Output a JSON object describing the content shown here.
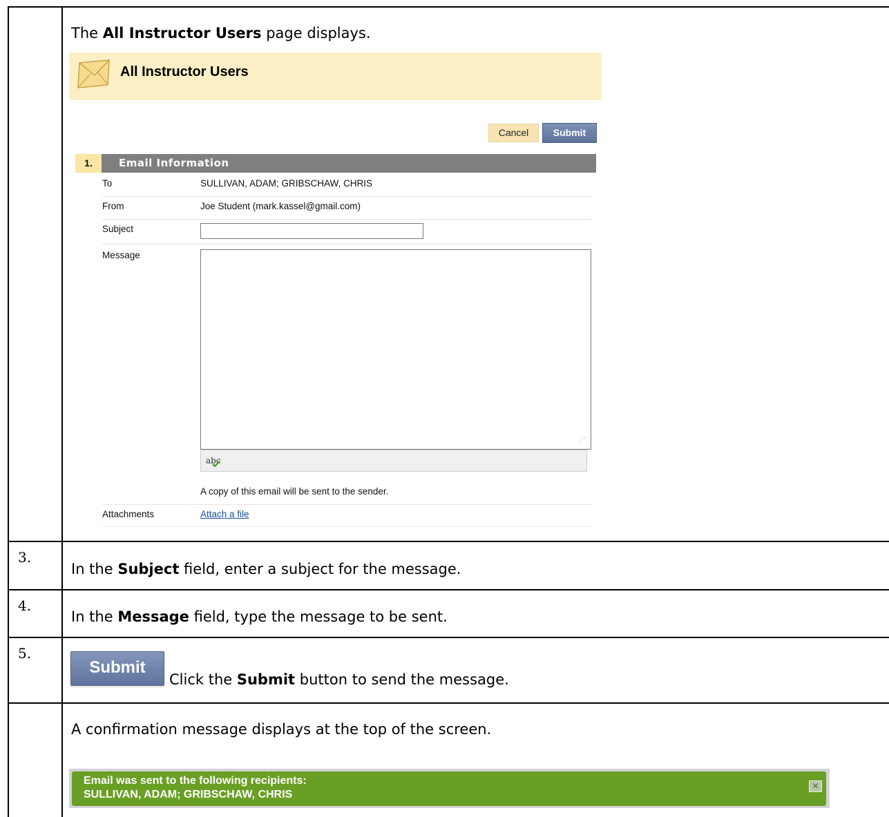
{
  "intro": {
    "prefix": "The ",
    "bold": "All Instructor Users",
    "suffix": " page displays."
  },
  "screenshot": {
    "page_title": "All Instructor Users",
    "icon": "envelope-icon",
    "buttons": {
      "cancel": "Cancel",
      "submit": "Submit"
    },
    "section": {
      "number": "1.",
      "title": "Email Information"
    },
    "fields": {
      "to_label": "To",
      "to_value": "SULLIVAN, ADAM; GRIBSCHAW, CHRIS",
      "from_label": "From",
      "from_value": "Joe Student (mark.kassel@gmail.com)",
      "subject_label": "Subject",
      "subject_value": "",
      "message_label": "Message",
      "message_value": "",
      "copy_note": "A copy of this email will be sent to the sender.",
      "attachments_label": "Attachments",
      "attach_link": "Attach a file"
    },
    "spellcheck_icon": "spellcheck-icon",
    "spellcheck_text": "abc"
  },
  "steps": [
    {
      "number": "3.",
      "prefix": "In the ",
      "bold": "Subject",
      "suffix": " field, enter a subject for the message."
    },
    {
      "number": "4.",
      "prefix": "In the ",
      "bold": "Message",
      "suffix": " field, type the message to be sent."
    },
    {
      "number": "5.",
      "button": "Submit",
      "prefix": "Click the ",
      "bold": "Submit",
      "suffix": " button to send the message."
    }
  ],
  "confirmation": {
    "intro": "A confirmation message displays at the top of the screen.",
    "line1": "Email was sent to the following recipients:",
    "line2": "SULLIVAN, ADAM; GRIBSCHAW, CHRIS",
    "close_icon": "close-icon",
    "close_glyph": "✕",
    "colors": {
      "background": "#6a9f25",
      "text": "#ffffff"
    }
  },
  "colors": {
    "header_bg": "#fcefc5",
    "section_bar": "#7f7f7f",
    "submit_button": "#6b7fa6",
    "link": "#1a4ea0"
  }
}
